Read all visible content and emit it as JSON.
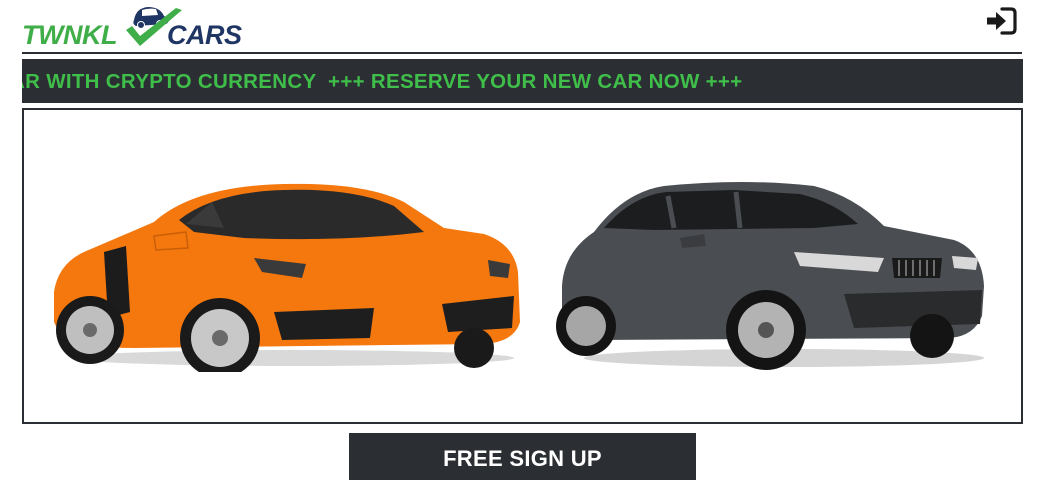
{
  "header": {
    "logo": {
      "part1": "TWNKL",
      "part2": "CARS"
    },
    "login_icon": "sign-in-icon"
  },
  "ticker": {
    "text": "AR WITH CRYPTO CURRENCY  +++ RESERVE YOUR NEW CAR NOW +++"
  },
  "banner": {
    "images": [
      "orange-sports-car",
      "dark-grey-sedan"
    ]
  },
  "cta": {
    "label": "FREE SIGN UP"
  },
  "colors": {
    "brand_green": "#3fae49",
    "brand_navy": "#1f3563",
    "dark_bar": "#2b2f33",
    "ticker_text": "#3fbf4a"
  }
}
